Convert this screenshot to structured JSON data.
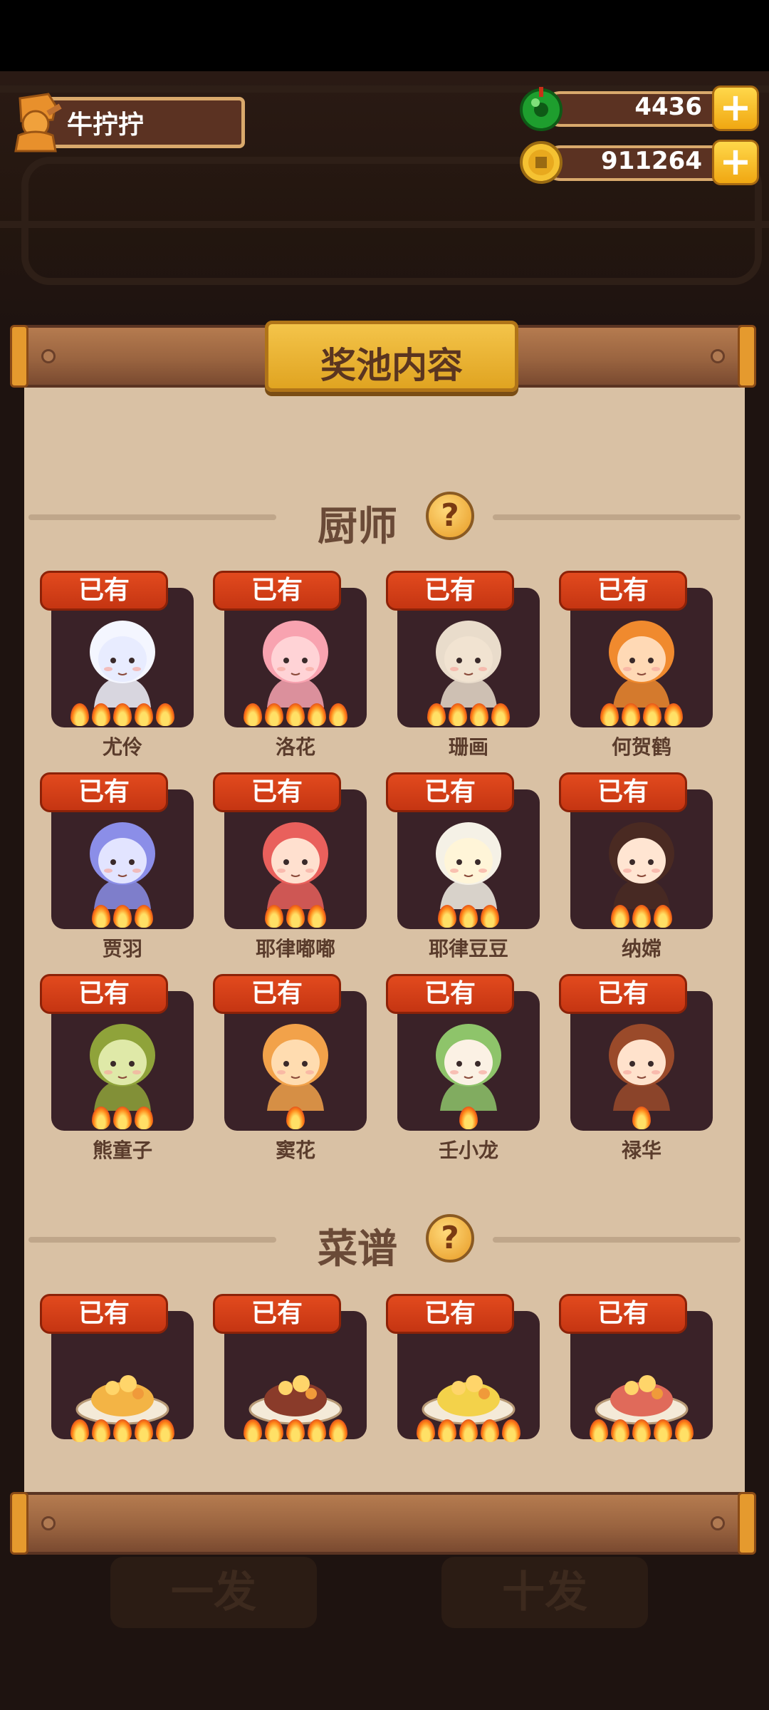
{
  "player": {
    "name": "牛拧拧"
  },
  "currency": {
    "jade": {
      "value": "4436",
      "icon": "jade-coin-icon"
    },
    "gold": {
      "value": "911264",
      "icon": "gold-coin-icon"
    }
  },
  "panel": {
    "title": "奖池内容"
  },
  "sections": {
    "chefs": {
      "title": "厨师"
    },
    "recipes": {
      "title": "菜谱"
    }
  },
  "owned_label": "已有",
  "chefs": [
    {
      "name": "尤伶",
      "stars": 5,
      "color": "#e8ecff",
      "hair": "#f4f6ff"
    },
    {
      "name": "洛花",
      "stars": 5,
      "color": "#ffd3d6",
      "hair": "#f8a3b0"
    },
    {
      "name": "珊画",
      "stars": 4,
      "color": "#f1e3d1",
      "hair": "#e9dccb"
    },
    {
      "name": "何贺鹤",
      "stars": 4,
      "color": "#ffd9b5",
      "hair": "#f08a2e"
    },
    {
      "name": "贾羽",
      "stars": 3,
      "color": "#e2e4ff",
      "hair": "#8b8ee8"
    },
    {
      "name": "耶律嘟嘟",
      "stars": 3,
      "color": "#ffe0cf",
      "hair": "#e9605c"
    },
    {
      "name": "耶律豆豆",
      "stars": 3,
      "color": "#fff5d8",
      "hair": "#f5f1e6"
    },
    {
      "name": "纳嫦",
      "stars": 3,
      "color": "#ffe5d2",
      "hair": "#4a2a22"
    },
    {
      "name": "熊童子",
      "stars": 3,
      "color": "#dfe9a8",
      "hair": "#8fa33a"
    },
    {
      "name": "窦花",
      "stars": 1,
      "color": "#ffdcb0",
      "hair": "#f2a24a"
    },
    {
      "name": "壬小龙",
      "stars": 1,
      "color": "#fbf1e4",
      "hair": "#8ec46a"
    },
    {
      "name": "禄华",
      "stars": 1,
      "color": "#ffe2cc",
      "hair": "#9a4a2a"
    }
  ],
  "recipes": [
    {
      "stars": 5,
      "color": "#f3b445"
    },
    {
      "stars": 5,
      "color": "#8a3b2a"
    },
    {
      "stars": 5,
      "color": "#f3d24a"
    },
    {
      "stars": 5,
      "color": "#e06a5a"
    }
  ],
  "bottom_buttons": {
    "single": "一发",
    "ten": "十发"
  }
}
